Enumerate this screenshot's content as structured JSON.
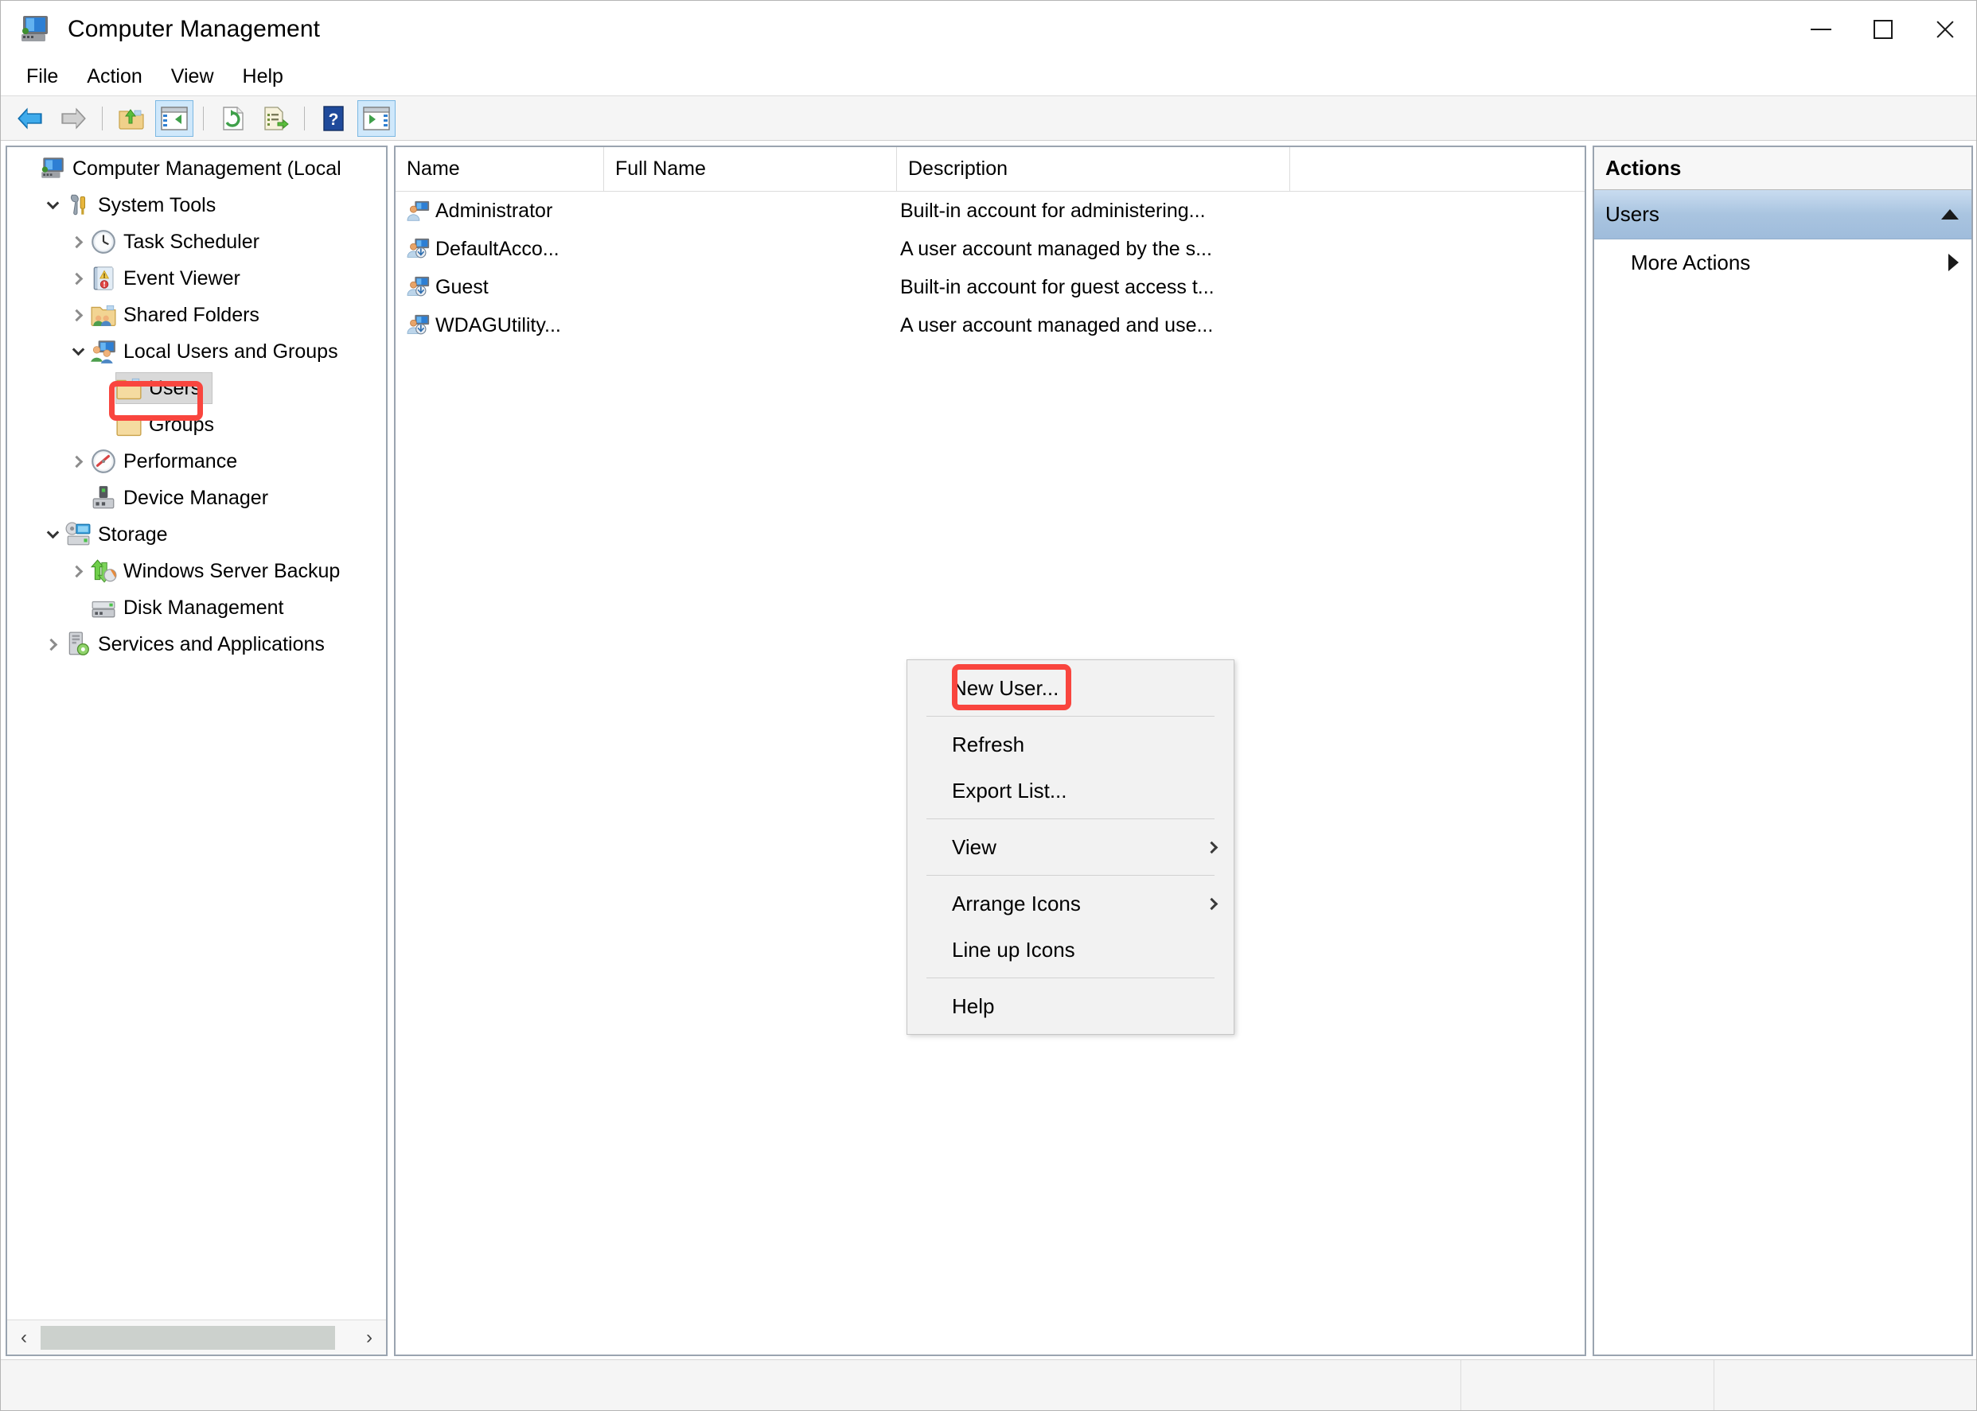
{
  "window": {
    "title": "Computer Management",
    "icon": "computer-management-icon",
    "controls": {
      "minimize": "minimize",
      "maximize": "maximize",
      "close": "close"
    }
  },
  "menubar": {
    "items": [
      "File",
      "Action",
      "View",
      "Help"
    ]
  },
  "toolbar": {
    "buttons": [
      {
        "name": "back-arrow-icon",
        "label": "Back"
      },
      {
        "name": "forward-arrow-icon",
        "label": "Forward"
      },
      {
        "name": "up-one-level-icon",
        "label": "Up One Level"
      },
      {
        "name": "show-hide-console-tree-icon",
        "label": "Show/Hide Console Tree",
        "active": true
      },
      {
        "name": "refresh-icon",
        "label": "Refresh"
      },
      {
        "name": "export-list-icon",
        "label": "Export List"
      },
      {
        "name": "help-icon",
        "label": "Help"
      },
      {
        "name": "show-hide-action-pane-icon",
        "label": "Show/Hide Action Pane",
        "active": true
      }
    ]
  },
  "tree": {
    "items": [
      {
        "label": "Computer Management (Local",
        "indent": 0,
        "twisty": "none",
        "icon": "computer-management-icon",
        "selected": false
      },
      {
        "label": "System Tools",
        "indent": 1,
        "twisty": "down",
        "icon": "system-tools-icon",
        "selected": false
      },
      {
        "label": "Task Scheduler",
        "indent": 2,
        "twisty": "right",
        "icon": "task-scheduler-icon",
        "selected": false
      },
      {
        "label": "Event Viewer",
        "indent": 2,
        "twisty": "right",
        "icon": "event-viewer-icon",
        "selected": false
      },
      {
        "label": "Shared Folders",
        "indent": 2,
        "twisty": "right",
        "icon": "shared-folders-icon",
        "selected": false
      },
      {
        "label": "Local Users and Groups",
        "indent": 2,
        "twisty": "down",
        "icon": "local-users-groups-icon",
        "selected": false
      },
      {
        "label": "Users",
        "indent": 3,
        "twisty": "none",
        "icon": "folder-icon",
        "selected": true
      },
      {
        "label": "Groups",
        "indent": 3,
        "twisty": "none",
        "icon": "folder-icon",
        "selected": false
      },
      {
        "label": "Performance",
        "indent": 2,
        "twisty": "right",
        "icon": "performance-icon",
        "selected": false
      },
      {
        "label": "Device Manager",
        "indent": 2,
        "twisty": "none",
        "icon": "device-manager-icon",
        "selected": false
      },
      {
        "label": "Storage",
        "indent": 1,
        "twisty": "down",
        "icon": "storage-icon",
        "selected": false
      },
      {
        "label": "Windows Server Backup",
        "indent": 2,
        "twisty": "right",
        "icon": "windows-server-backup-icon",
        "selected": false
      },
      {
        "label": "Disk Management",
        "indent": 2,
        "twisty": "none",
        "icon": "disk-management-icon",
        "selected": false
      },
      {
        "label": "Services and Applications",
        "indent": 1,
        "twisty": "right",
        "icon": "services-applications-icon",
        "selected": false
      }
    ],
    "hscroll": {
      "left_arrow": "‹",
      "right_arrow": "›"
    }
  },
  "list": {
    "columns": [
      "Name",
      "Full Name",
      "Description"
    ],
    "rows": [
      {
        "name": "Administrator",
        "full_name": "",
        "description": "Built-in account for administering...",
        "icon": "user-account-icon"
      },
      {
        "name": "DefaultAcco...",
        "full_name": "",
        "description": "A user account managed by the s...",
        "icon": "user-account-disabled-icon"
      },
      {
        "name": "Guest",
        "full_name": "",
        "description": "Built-in account for guest access t...",
        "icon": "user-account-disabled-icon"
      },
      {
        "name": "WDAGUtility...",
        "full_name": "",
        "description": "A user account managed and use...",
        "icon": "user-account-disabled-icon"
      }
    ]
  },
  "context_menu": {
    "items": [
      {
        "label": "New User...",
        "submenu": false,
        "highlighted": true,
        "separator_after": true
      },
      {
        "label": "Refresh",
        "submenu": false,
        "highlighted": false,
        "separator_after": false
      },
      {
        "label": "Export List...",
        "submenu": false,
        "highlighted": false,
        "separator_after": true
      },
      {
        "label": "View",
        "submenu": true,
        "highlighted": false,
        "separator_after": true
      },
      {
        "label": "Arrange Icons",
        "submenu": true,
        "highlighted": false,
        "separator_after": false
      },
      {
        "label": "Line up Icons",
        "submenu": false,
        "highlighted": false,
        "separator_after": true
      },
      {
        "label": "Help",
        "submenu": false,
        "highlighted": false,
        "separator_after": false
      }
    ]
  },
  "actions": {
    "header": "Actions",
    "group_label": "Users",
    "items": [
      "More Actions"
    ]
  },
  "statusbar": {
    "segments": [
      "",
      "",
      ""
    ]
  },
  "colors": {
    "annotation_red": "#f9453e",
    "selection_gray": "#d9d9d9",
    "actions_group_blue": "#a9c4e0",
    "toolbar_active_blue": "#cfe8fb"
  }
}
